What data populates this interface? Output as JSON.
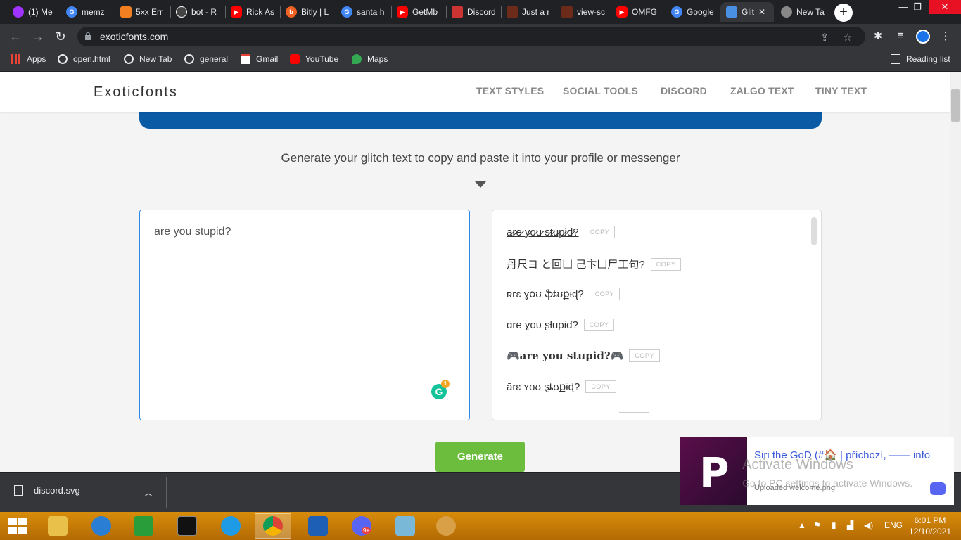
{
  "browser": {
    "tabs": [
      {
        "label": "(1) Mes",
        "icon": "messenger-icon",
        "color": "#a033ff"
      },
      {
        "label": "memz",
        "icon": "google-icon",
        "color": "#4285f4"
      },
      {
        "label": "5xx Err",
        "icon": "cloudflare-icon",
        "color": "#f38020"
      },
      {
        "label": "bot - R",
        "icon": "replit-icon",
        "color": "#222222"
      },
      {
        "label": "Rick As",
        "icon": "youtube-icon",
        "color": "#ff0000"
      },
      {
        "label": "Bitly | L",
        "icon": "bitly-icon",
        "color": "#ee6123"
      },
      {
        "label": "santa h",
        "icon": "google-icon",
        "color": "#4285f4"
      },
      {
        "label": "GetMb",
        "icon": "youtube-icon",
        "color": "#ff0000"
      },
      {
        "label": "Discord",
        "icon": "file-icon",
        "color": "#cc3333"
      },
      {
        "label": "Just a r",
        "icon": "image-icon",
        "color": "#6b2a1a"
      },
      {
        "label": "view-sc",
        "icon": "image-icon",
        "color": "#6b2a1a"
      },
      {
        "label": "OMFG",
        "icon": "youtube-icon",
        "color": "#ff0000"
      },
      {
        "label": "Google",
        "icon": "google-icon",
        "color": "#4285f4"
      },
      {
        "label": "Glit",
        "icon": "exoticfonts-icon",
        "color": "#4a90e2"
      },
      {
        "label": "New Ta",
        "icon": "chrome-icon",
        "color": "#888888"
      }
    ],
    "new_tab_label": "+",
    "url": "exoticfonts.com",
    "bookmarks": [
      {
        "label": "Apps",
        "icon": "apps-grid-icon",
        "color": "#ea4335"
      },
      {
        "label": "open.html",
        "icon": "globe-icon",
        "color": "#e8eaed"
      },
      {
        "label": "New Tab",
        "icon": "globe-icon",
        "color": "#e8eaed"
      },
      {
        "label": "general",
        "icon": "globe-icon",
        "color": "#e8eaed"
      },
      {
        "label": "Gmail",
        "icon": "gmail-icon",
        "color": "#ea4335"
      },
      {
        "label": "YouTube",
        "icon": "youtube-icon",
        "color": "#ff0000"
      },
      {
        "label": "Maps",
        "icon": "maps-icon",
        "color": "#34a853"
      }
    ],
    "reading_list": "Reading list"
  },
  "site": {
    "logo": "Exoticfonts",
    "nav": [
      "TEXT STYLES",
      "SOCIAL TOOLS",
      "DISCORD",
      "ZALGO TEXT",
      "TINY TEXT"
    ],
    "subtitle": "Generate your glitch text to copy and paste it into your profile or messenger",
    "input_text": "are you stupid?",
    "grammarly_badge": "1",
    "outputs": [
      {
        "text": "a̷r̷e̷ y̷o̷u̷ s̷t̷u̷p̷i̷d̷?",
        "copy": "COPY"
      },
      {
        "text": "丹尺ヨ と回凵 己卞凵尸工句?",
        "copy": "COPY"
      },
      {
        "text": "ʀгɛ ɣօʊ ֆȶʊքɨɖ?",
        "copy": "COPY"
      },
      {
        "text": "ɑre ɣoʋ ʂƚuρiɗ?",
        "copy": "COPY"
      },
      {
        "text": "🎮are you stupid?🎮",
        "copy": "COPY"
      },
      {
        "text": "ārɛ ʏoʊ ȿȶʊքɨɖ?",
        "copy": "COPY"
      }
    ],
    "generate_label": "Generate"
  },
  "download": {
    "filename": "discord.svg"
  },
  "toast": {
    "title": "Siri the GoD (#🏠 | příchozí, —— info",
    "subtitle": "Uploaded welcome.png"
  },
  "watermark": {
    "line1": "Activate Windows",
    "line2": "Go to PC settings to activate Windows."
  },
  "taskbar": {
    "apps": [
      {
        "name": "file-explorer-icon",
        "color": "#e8c04a"
      },
      {
        "name": "internet-explorer-icon",
        "color": "#2a7fd4"
      },
      {
        "name": "store-icon",
        "color": "#2a9d3b"
      },
      {
        "name": "cmd-icon",
        "color": "#111111"
      },
      {
        "name": "edge-icon",
        "color": "#1f9be6"
      },
      {
        "name": "chrome-icon",
        "color": "#db4437"
      },
      {
        "name": "defender-icon",
        "color": "#1c5fb5"
      },
      {
        "name": "discord-icon",
        "color": "#5865f2"
      },
      {
        "name": "notepad-icon",
        "color": "#7ab8d8"
      },
      {
        "name": "paint-icon",
        "color": "#d9a048"
      }
    ],
    "discord_badge": "9+",
    "language": "ENG",
    "time": "6:01 PM",
    "date": "12/10/2021"
  }
}
